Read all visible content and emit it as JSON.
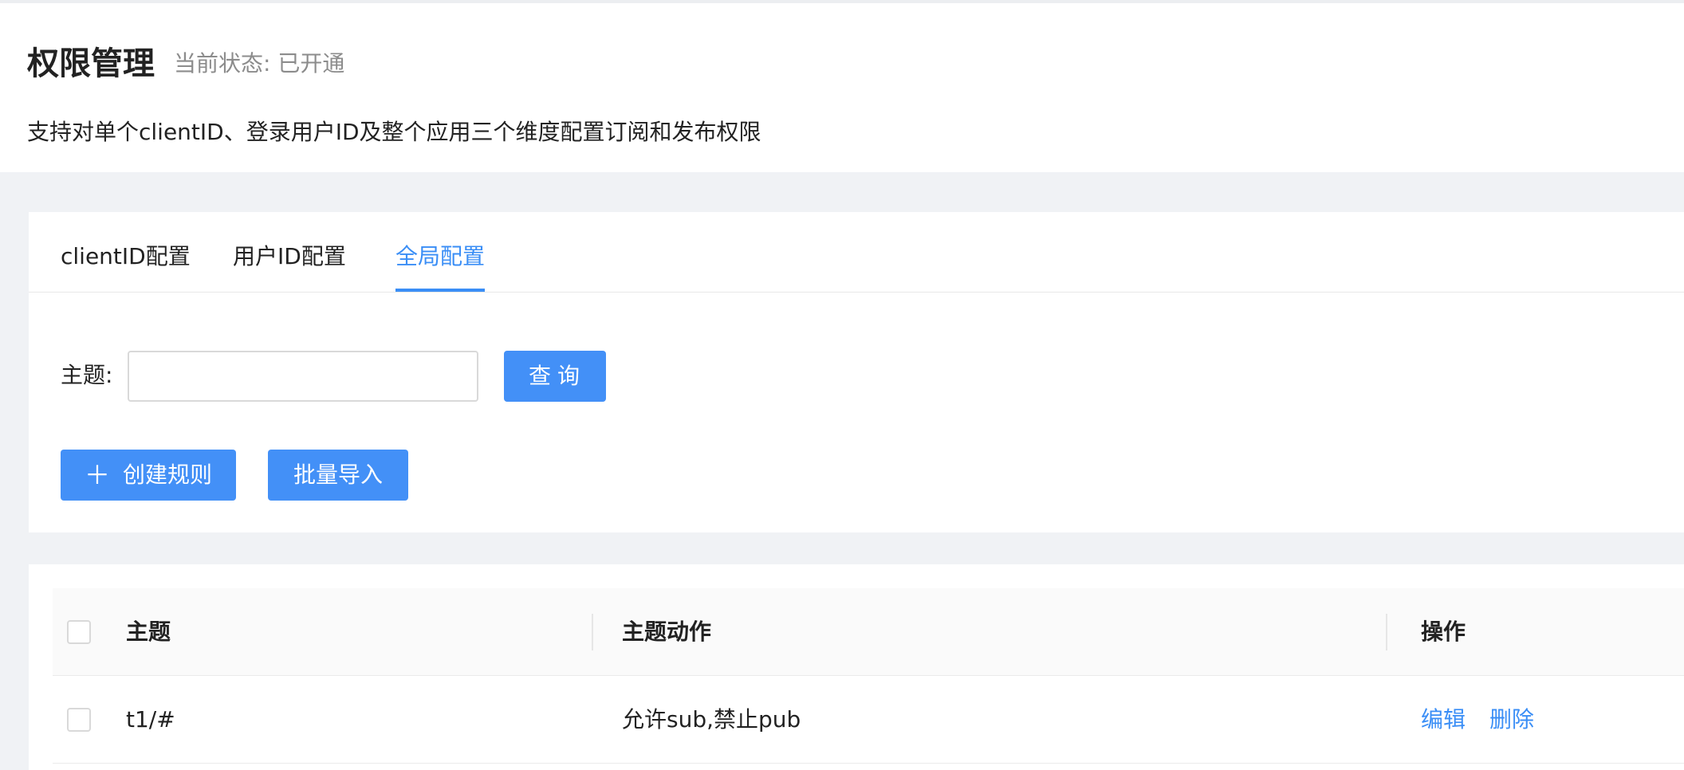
{
  "header": {
    "title": "权限管理",
    "status": "当前状态: 已开通",
    "description": "支持对单个clientID、登录用户ID及整个应用三个维度配置订阅和发布权限"
  },
  "tabs": [
    {
      "label": "clientID配置",
      "active": false
    },
    {
      "label": "用户ID配置",
      "active": false
    },
    {
      "label": "全局配置",
      "active": true
    }
  ],
  "search": {
    "label": "主题:",
    "value": "",
    "placeholder": "",
    "button_label": "查询"
  },
  "actions": {
    "create_label": "创建规则",
    "create_icon": "plus-icon",
    "import_label": "批量导入"
  },
  "table": {
    "columns": [
      "主题",
      "主题动作",
      "操作"
    ],
    "rows": [
      {
        "topic": "t1/#",
        "action": "允许sub,禁止pub",
        "ops": [
          "编辑",
          "删除"
        ]
      }
    ]
  },
  "colors": {
    "accent": "#3a8ef6",
    "button": "#4390f7",
    "background": "#f0f2f5"
  }
}
